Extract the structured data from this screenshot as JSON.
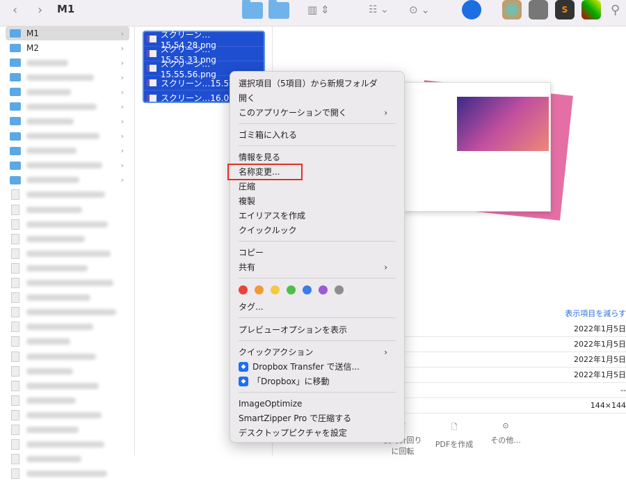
{
  "toolbar": {
    "title": "M1"
  },
  "sidebar": {
    "items": [
      {
        "label": "M1"
      },
      {
        "label": "M2"
      }
    ]
  },
  "files": [
    "スクリーン…15.54.28.png",
    "スクリーン…15.55.33.png",
    "スクリーン…15.55.56.png",
    "スクリーン…15.58.",
    "スクリーン…16.06."
  ],
  "menu": {
    "new_folder": "選択項目（5項目）から新規フォルダ",
    "open": "開く",
    "open_with": "このアプリケーションで開く",
    "trash": "ゴミ箱に入れる",
    "get_info": "情報を見る",
    "rename": "名称変更...",
    "compress": "圧縮",
    "duplicate": "複製",
    "alias": "エイリアスを作成",
    "quicklook": "クイックルック",
    "copy": "コピー",
    "share": "共有",
    "tags": "タグ...",
    "preview_options": "プレビューオプションを表示",
    "quick_actions": "クイックアクション",
    "dropbox_transfer": "Dropbox Transfer で送信...",
    "dropbox_move": "「Dropbox」に移動",
    "imageoptimize": "ImageOptimize",
    "smartzipper": "SmartZipper Pro で圧縮する",
    "desktop_picture": "デスクトップピクチャを設定"
  },
  "tag_colors": [
    "#e8443a",
    "#f29a38",
    "#f5c842",
    "#4cc048",
    "#3a7de8",
    "#9a5bd6",
    "#8e8e8e"
  ],
  "info": {
    "show_less": "表示項目を減らす",
    "rows": [
      "2022年1月5日",
      "2022年1月5日",
      "2022年1月5日",
      "2022年1月5日",
      "--",
      "144×144"
    ]
  },
  "actions": {
    "rotate": "反時計回りに回転",
    "pdf": "PDFを作成",
    "more": "その他..."
  }
}
